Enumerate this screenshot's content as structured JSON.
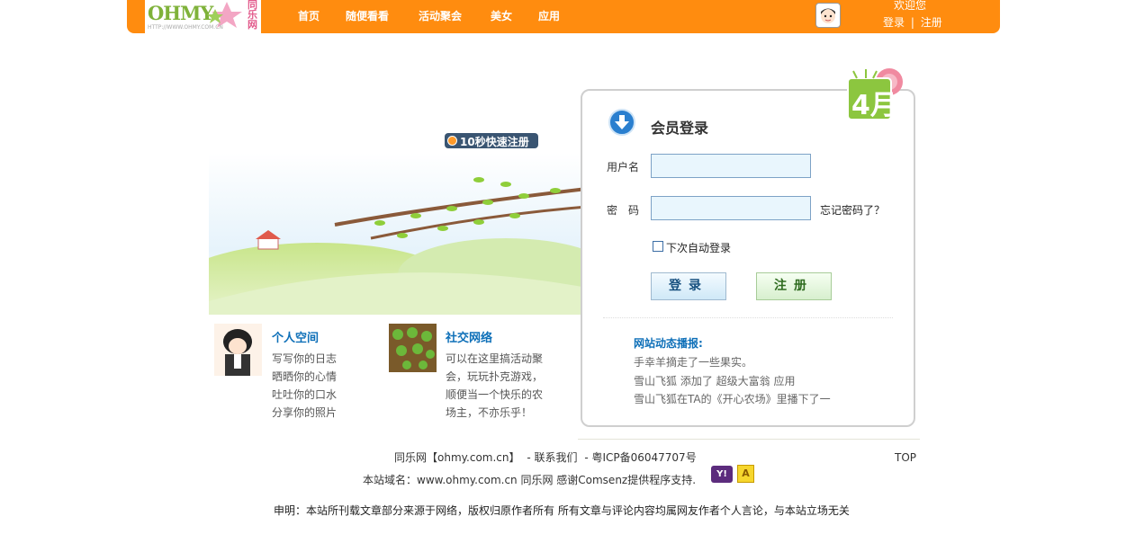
{
  "header": {
    "logo": {
      "brand": "OHMY",
      "cn": "同乐网",
      "url": "HTTP://WWW.OHMY.COM.CN"
    },
    "nav": [
      "首页",
      "随便看看",
      "活动聚会",
      "美女",
      "应用"
    ],
    "welcome": "欢迎您",
    "login_link": "登录",
    "divider": "|",
    "register_link": "注册"
  },
  "promo": {
    "quick_register": "10秒快速注册"
  },
  "badge": {
    "label": "4月"
  },
  "features": [
    {
      "title": "个人空间",
      "lines": [
        "写写你的日志",
        "晒晒你的心情",
        "吐吐你的口水",
        "分享你的照片"
      ]
    },
    {
      "title": "社交网络",
      "lines": [
        "可以在这里搞活动聚",
        "会，玩玩扑克游戏，",
        "顺便当一个快乐的农",
        "场主，不亦乐乎！"
      ]
    }
  ],
  "login": {
    "title": "会员登录",
    "username_label": "用户名",
    "password_label": "密　码",
    "username_value": "",
    "password_value": "",
    "forgot": "忘记密码了？",
    "remember": "下次自动登录",
    "login_button": "登录",
    "register_button": "注册"
  },
  "news": {
    "title": "网站动态播报:",
    "items": [
      "手幸羊摘走了一些果实。",
      "雪山飞狐  添加了  超级大富翁  应用",
      "雪山飞狐在TA的《开心农场》里播下了一"
    ]
  },
  "footer": {
    "line1_site": "同乐网【ohmy.com.cn】",
    "line1_contact": "- 联系我们",
    "line1_icp": "- 粤ICP备06047707号",
    "line2": "本站域名：www.ohmy.com.cn 同乐网 感谢Comsenz提供程序支持.",
    "top": "TOP",
    "disclaimer": "申明：本站所刊载文章部分来源于网络，版权归原作者所有  所有文章与评论内容均属网友作者个人言论，与本站立场无关",
    "y_icon": "Y!",
    "a_icon": "A"
  },
  "colors": {
    "header": "#ff8c0f",
    "link": "#0d6fb8",
    "input_bg": "#e9f6fd"
  }
}
